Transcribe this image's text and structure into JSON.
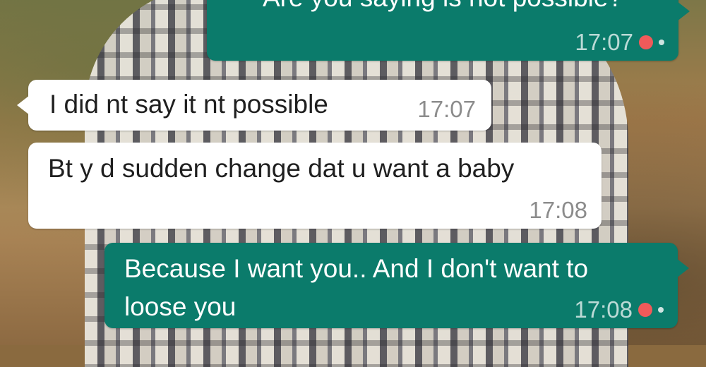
{
  "messages": [
    {
      "direction": "outgoing",
      "text": "Are you saying is not possible?",
      "time": "17:07",
      "status_icon": "red-dot-icon"
    },
    {
      "direction": "incoming",
      "text": "I did nt say it nt possible",
      "time": "17:07"
    },
    {
      "direction": "incoming",
      "text": "Bt y d sudden change dat u want a baby",
      "time": "17:08"
    },
    {
      "direction": "outgoing",
      "text": "Because I want you.. And I don't want to loose you",
      "time": "17:08",
      "status_icon": "red-dot-icon"
    }
  ],
  "colors": {
    "outgoing_bubble": "#0b7b6b",
    "incoming_bubble": "#ffffff",
    "status_dot": "#f05a5a"
  }
}
